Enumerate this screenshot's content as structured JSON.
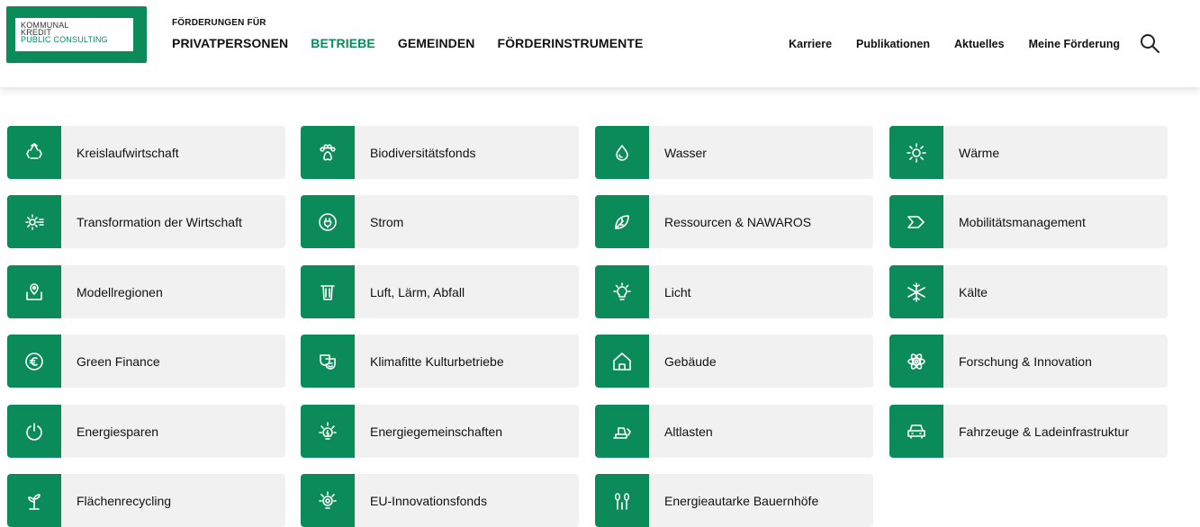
{
  "brand": {
    "logo_lines": [
      "KOMMUNAL",
      "KREDIT",
      "PUBLIC CONSULTING"
    ],
    "accent_color": "#0b8a5a"
  },
  "header": {
    "fund_label": "FÖRDERUNGEN FÜR",
    "main_nav": [
      {
        "label": "PRIVATPERSONEN",
        "active": false
      },
      {
        "label": "BETRIEBE",
        "active": true
      },
      {
        "label": "GEMEINDEN",
        "active": false
      },
      {
        "label": "FÖRDERINSTRUMENTE",
        "active": false
      }
    ],
    "secondary_nav": [
      "Karriere",
      "Publikationen",
      "Aktuelles",
      "Meine Förderung"
    ],
    "search_icon": "search-icon"
  },
  "tiles": [
    {
      "label": "Kreislaufwirtschaft",
      "icon": "recycle-icon"
    },
    {
      "label": "Biodiversitätsfonds",
      "icon": "paw-icon"
    },
    {
      "label": "Wasser",
      "icon": "water-drop-icon"
    },
    {
      "label": "Wärme",
      "icon": "sun-icon"
    },
    {
      "label": "Transformation der Wirtschaft",
      "icon": "gear-icon"
    },
    {
      "label": "Strom",
      "icon": "plug-icon"
    },
    {
      "label": "Ressourcen & NAWAROS",
      "icon": "leaf-icon"
    },
    {
      "label": "Mobilitätsmanagement",
      "icon": "chevron-arrow-icon"
    },
    {
      "label": "Modellregionen",
      "icon": "map-pin-icon"
    },
    {
      "label": "Luft, Lärm, Abfall",
      "icon": "trash-bin-icon"
    },
    {
      "label": "Licht",
      "icon": "light-bulb-icon"
    },
    {
      "label": "Kälte",
      "icon": "snowflake-icon"
    },
    {
      "label": "Green Finance",
      "icon": "euro-icon"
    },
    {
      "label": "Klimafitte Kulturbetriebe",
      "icon": "theater-masks-icon"
    },
    {
      "label": "Gebäude",
      "icon": "house-icon"
    },
    {
      "label": "Forschung & Innovation",
      "icon": "atom-icon"
    },
    {
      "label": "Energiesparen",
      "icon": "power-icon"
    },
    {
      "label": "Energiegemeinschaften",
      "icon": "energy-sun-icon"
    },
    {
      "label": "Altlasten",
      "icon": "excavator-icon"
    },
    {
      "label": "Fahrzeuge & Ladeinfrastruktur",
      "icon": "car-icon"
    },
    {
      "label": "Flächenrecycling",
      "icon": "sprout-icon"
    },
    {
      "label": "EU-Innovationsfonds",
      "icon": "innovation-bulb-icon"
    },
    {
      "label": "Energieautarke Bauernhöfe",
      "icon": "trees-icon"
    }
  ]
}
